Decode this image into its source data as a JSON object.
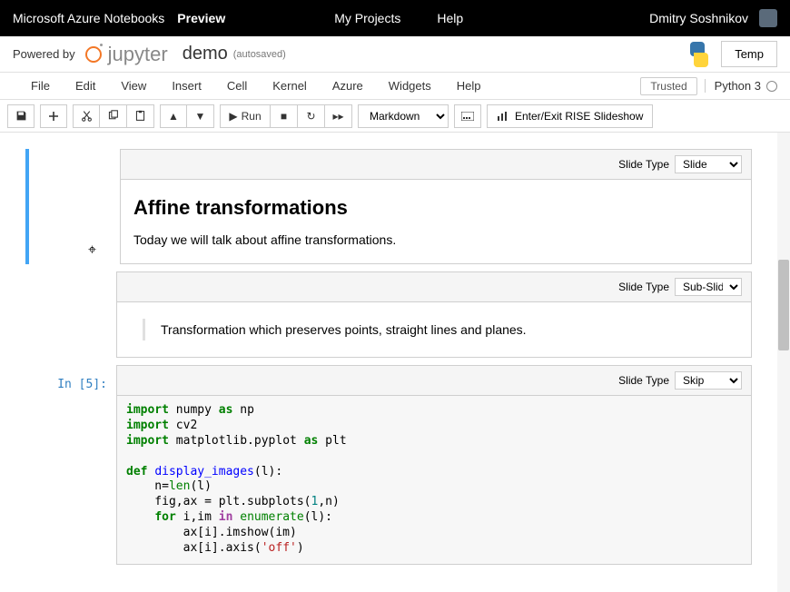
{
  "topbar": {
    "brand": "Microsoft Azure Notebooks",
    "preview": "Preview",
    "myprojects": "My Projects",
    "help": "Help",
    "user": "Dmitry Soshnikov"
  },
  "header": {
    "powered": "Powered by",
    "jupyter": "jupyter",
    "nbname": "demo",
    "autosave": "(autosaved)",
    "temp": "Temp"
  },
  "menus": [
    "File",
    "Edit",
    "View",
    "Insert",
    "Cell",
    "Kernel",
    "Azure",
    "Widgets",
    "Help"
  ],
  "trusted": "Trusted",
  "kernel": "Python 3",
  "run": "Run",
  "celltype": "Markdown",
  "rise": "Enter/Exit RISE Slideshow",
  "slidetype_label": "Slide Type",
  "cells": {
    "c1": {
      "slide": "Slide",
      "title": "Affine transformations",
      "text": "Today we will talk about affine transformations."
    },
    "c2": {
      "slide": "Sub-Slide",
      "text": "Transformation which preserves points, straight lines and planes."
    },
    "c3": {
      "prompt": "In [5]:",
      "slide": "Skip"
    }
  }
}
